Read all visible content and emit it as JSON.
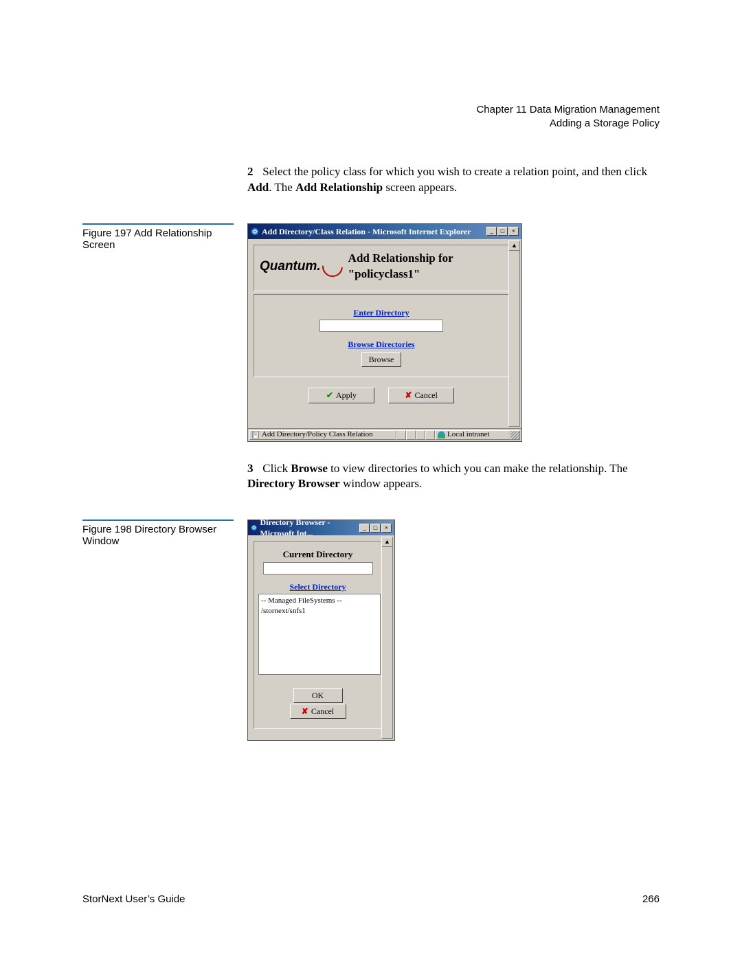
{
  "header": {
    "chapter_line": "Chapter 11  Data Migration Management",
    "section_line": "Adding a Storage Policy"
  },
  "step2": {
    "num": "2",
    "text_a": "Select the policy class for which you wish to create a relation point, and then click ",
    "bold_a": "Add",
    "text_b": ". The ",
    "bold_b": "Add Relationship",
    "text_c": " screen appears."
  },
  "fig197": {
    "caption": "Figure 197  Add Relationship Screen",
    "window_title": "Add Directory/Class Relation - Microsoft Internet Explorer",
    "brand": "Quantum.",
    "heading": "Add Relationship for \"policyclass1\"",
    "enter_dir_label": "Enter Directory",
    "enter_dir_value": "",
    "browse_dir_label": "Browse Directories",
    "browse_btn": "Browse",
    "apply_btn": "Apply",
    "cancel_btn": "Cancel",
    "status_left": "Add Directory/Policy Class Relation",
    "status_right": "Local intranet"
  },
  "step3": {
    "num": "3",
    "text_a": "Click ",
    "bold_a": "Browse",
    "text_b": " to view directories to which you can make the relationship. The ",
    "bold_b": "Directory Browser",
    "text_c": " window appears."
  },
  "fig198": {
    "caption": "Figure 198  Directory Browser Window",
    "window_title": "Directory Browser - Microsoft Int...",
    "current_dir_label": "Current Directory",
    "current_dir_value": "",
    "select_dir_label": "Select Directory",
    "list_line1": "-- Managed FileSystems --",
    "list_line2": "/stornext/snfs1",
    "ok_btn": "OK",
    "cancel_btn": "Cancel"
  },
  "footer": {
    "left": "StorNext User’s Guide",
    "right": "266"
  }
}
